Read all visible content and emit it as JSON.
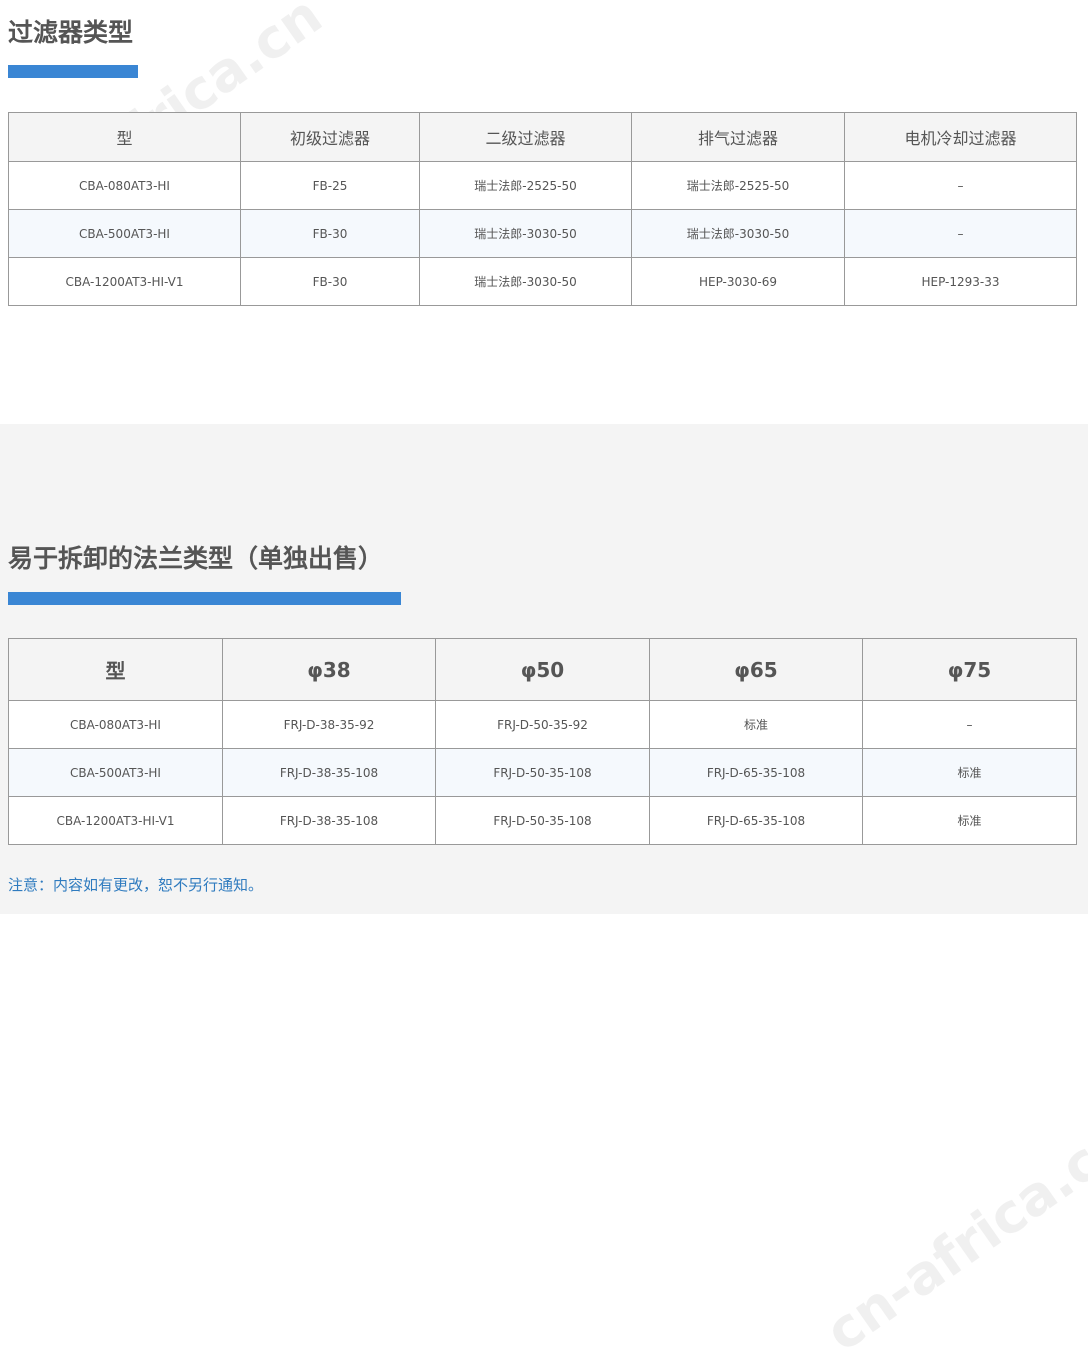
{
  "section1": {
    "title": "过滤器类型",
    "table": {
      "headers": [
        "型",
        "初级过滤器",
        "二级过滤器",
        "排气过滤器",
        "电机冷却过滤器"
      ],
      "rows": [
        [
          "CBA-080AT3-HI",
          "FB-25",
          "瑞士法郎-2525-50",
          "瑞士法郎-2525-50",
          "–"
        ],
        [
          "CBA-500AT3-HI",
          "FB-30",
          "瑞士法郎-3030-50",
          "瑞士法郎-3030-50",
          "–"
        ],
        [
          "CBA-1200AT3-HI-V1",
          "FB-30",
          "瑞士法郎-3030-50",
          "HEP-3030-69",
          "HEP-1293-33"
        ]
      ]
    }
  },
  "section2": {
    "title": "易于拆卸的法兰类型（单独出售）",
    "table": {
      "headers": [
        "型",
        "φ38",
        "φ50",
        "φ65",
        "φ75"
      ],
      "rows": [
        [
          "CBA-080AT3-HI",
          "FRJ-D-38-35-92",
          "FRJ-D-50-35-92",
          "标准",
          "–"
        ],
        [
          "CBA-500AT3-HI",
          "FRJ-D-38-35-108",
          "FRJ-D-50-35-108",
          "FRJ-D-65-35-108",
          "标准"
        ],
        [
          "CBA-1200AT3-HI-V1",
          "FRJ-D-38-35-108",
          "FRJ-D-50-35-108",
          "FRJ-D-65-35-108",
          "标准"
        ]
      ]
    },
    "note": "注意：内容如有更改，恕不另行通知。"
  },
  "watermark": "cn-africa.cn",
  "colors": {
    "accent": "#3a86d4",
    "note": "#2f7bbf",
    "border": "#999999"
  }
}
